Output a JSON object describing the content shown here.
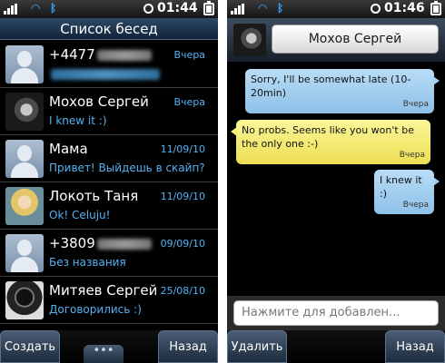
{
  "left": {
    "status": {
      "time": "01:44"
    },
    "title": "Список бесед",
    "conversations": [
      {
        "name": "+4477",
        "preview": "",
        "date": "Вчера",
        "avatar": "default-contact"
      },
      {
        "name": "Мохов Сергей",
        "preview": "I knew it :)",
        "date": "Вчера",
        "avatar": "photo"
      },
      {
        "name": "Мама",
        "preview": "Привет! Выйдешь в скайп?",
        "date": "11/09/10",
        "avatar": "default-contact"
      },
      {
        "name": "Локоть Таня",
        "preview": "Ok! Celuju!",
        "date": "11/09/10",
        "avatar": "photo"
      },
      {
        "name": "+3809",
        "preview": "Без названия",
        "date": "09/09/10",
        "avatar": "default-contact"
      },
      {
        "name": "Митяев Сергей",
        "preview": "Договорились :)",
        "date": "25/08/10",
        "avatar": "photo"
      }
    ],
    "buttons": {
      "create": "Создать",
      "more": "•••",
      "back": "Назад"
    }
  },
  "right": {
    "status": {
      "time": "01:46"
    },
    "contact_name": "Мохов Сергей",
    "messages": [
      {
        "direction": "out",
        "text": "Sorry, I'll be somewhat late (10-20min)",
        "time": "Вчера"
      },
      {
        "direction": "in",
        "text": "No probs. Seems like you won't be the only one :-)",
        "time": "Вчера"
      },
      {
        "direction": "out",
        "text": "I knew it :)",
        "time": "Вчера"
      }
    ],
    "input_placeholder": "Нажмите для добавлен...",
    "buttons": {
      "delete": "Удалить",
      "back": "Назад"
    }
  },
  "colors": {
    "accent_blue": "#54b2f2",
    "incoming_bubble": "#f6ee79",
    "outgoing_bubble": "#a5cff0"
  }
}
